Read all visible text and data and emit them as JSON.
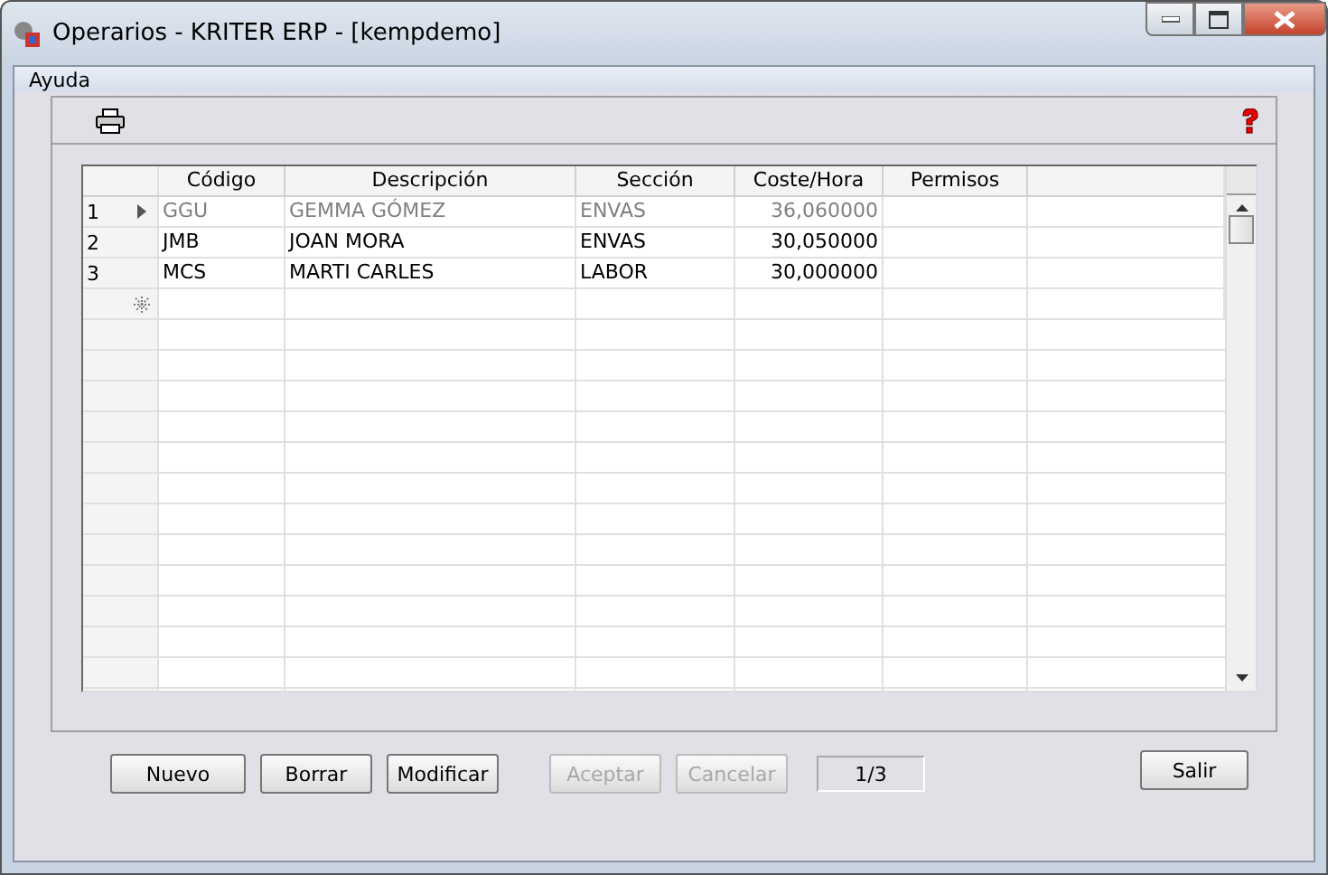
{
  "window": {
    "title": "Operarios - KRITER ERP - [kempdemo]"
  },
  "menu": [
    "Ayuda"
  ],
  "table": {
    "columns": [
      "Código",
      "Descripción",
      "Sección",
      "Coste/Hora",
      "Permisos"
    ],
    "rows": [
      {
        "number": "1",
        "selected": true,
        "cells": [
          "GGU",
          "GEMMA GÓMEZ",
          "ENVAS",
          "36,060000",
          ""
        ]
      },
      {
        "number": "2",
        "selected": false,
        "cells": [
          "JMB",
          "JOAN MORA",
          "ENVAS",
          "30,050000",
          ""
        ]
      },
      {
        "number": "3",
        "selected": false,
        "cells": [
          "MCS",
          "MARTI CARLES",
          "LABOR",
          "30,000000",
          ""
        ]
      }
    ]
  },
  "buttons": [
    {
      "label": "Nuevo",
      "disabled": false
    },
    {
      "label": "Borrar",
      "disabled": false
    },
    {
      "label": "Modificar",
      "disabled": false
    },
    {
      "label": "Aceptar",
      "disabled": true
    },
    {
      "label": "Cancelar",
      "disabled": true
    }
  ],
  "record_counter": "1/3",
  "exit_button": {
    "label": "Salir",
    "disabled": false
  }
}
